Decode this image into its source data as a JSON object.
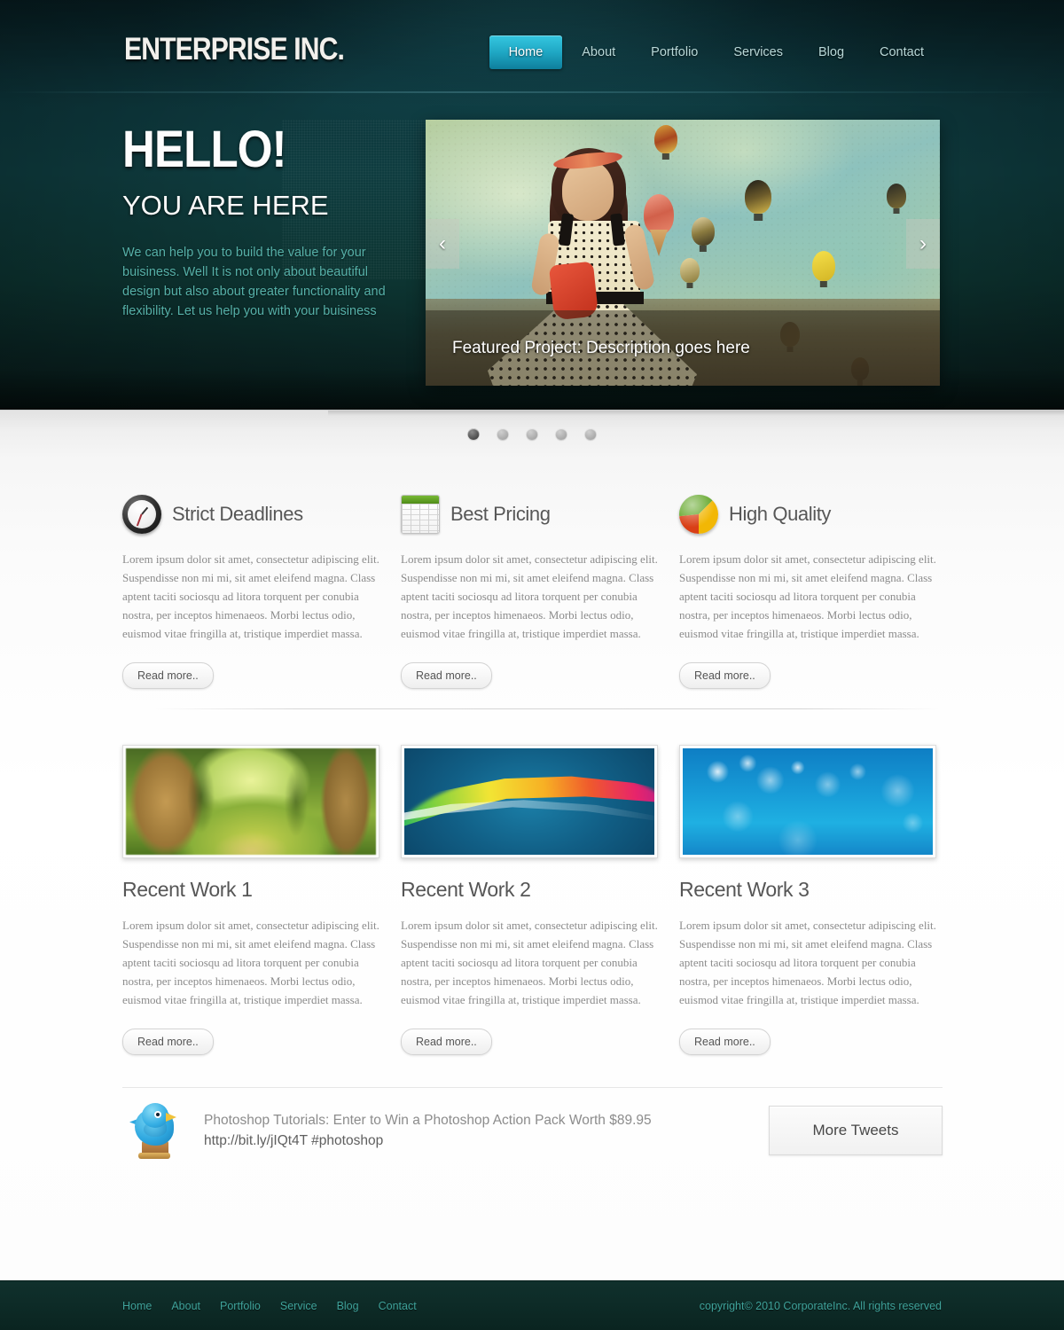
{
  "site": {
    "logo": "ENTERPRISE INC."
  },
  "nav": {
    "items": [
      {
        "label": "Home",
        "active": true
      },
      {
        "label": "About",
        "active": false
      },
      {
        "label": "Portfolio",
        "active": false
      },
      {
        "label": "Services",
        "active": false
      },
      {
        "label": "Blog",
        "active": false
      },
      {
        "label": "Contact",
        "active": false
      }
    ]
  },
  "hero": {
    "title": "HELLO!",
    "subtitle": "YOU ARE HERE",
    "paragraph": "We can help you to build the value for your buisiness. Well It is not only about beautiful design but also about greater functionality and flexibility. Let us help you with your buisiness"
  },
  "slider": {
    "caption": "Featured Project: Description goes here",
    "prev_arrow": "‹",
    "next_arrow": "›",
    "pagination": [
      {
        "index": 1,
        "active": true
      },
      {
        "index": 2,
        "active": false
      },
      {
        "index": 3,
        "active": false
      },
      {
        "index": 4,
        "active": false
      },
      {
        "index": 5,
        "active": false
      }
    ]
  },
  "features": [
    {
      "icon": "clock-icon",
      "title": "Strict Deadlines",
      "body": "Lorem ipsum dolor sit amet, consectetur adipiscing elit. Suspendisse non mi mi, sit amet eleifend magna. Class aptent taciti sociosqu ad litora torquent per conubia nostra, per inceptos himenaeos. Morbi lectus odio, euismod vitae fringilla at, tristique imperdiet massa.",
      "read_more": "Read more.."
    },
    {
      "icon": "spreadsheet-icon",
      "title": "Best Pricing",
      "body": "Lorem ipsum dolor sit amet, consectetur adipiscing elit. Suspendisse non mi mi, sit amet eleifend magna. Class aptent taciti sociosqu ad litora torquent per conubia nostra, per inceptos himenaeos. Morbi lectus odio, euismod vitae fringilla at, tristique imperdiet massa.",
      "read_more": "Read more.."
    },
    {
      "icon": "pie-chart-icon",
      "title": "High Quality",
      "body": "Lorem ipsum dolor sit amet, consectetur adipiscing elit. Suspendisse non mi mi, sit amet eleifend magna. Class aptent taciti sociosqu ad litora torquent per conubia nostra, per inceptos himenaeos. Morbi lectus odio, euismod vitae fringilla at, tristique imperdiet massa.",
      "read_more": "Read more.."
    }
  ],
  "works": [
    {
      "title": "Recent Work 1",
      "image": "forest-path-photo",
      "body": "Lorem ipsum dolor sit amet, consectetur adipiscing elit. Suspendisse non mi mi, sit amet eleifend magna. Class aptent taciti sociosqu ad litora torquent per conubia nostra, per inceptos himenaeos. Morbi lectus odio, euismod vitae fringilla at, tristique imperdiet massa.",
      "read_more": "Read more.."
    },
    {
      "title": "Recent Work 2",
      "image": "rainbow-wave-graphic",
      "body": "Lorem ipsum dolor sit amet, consectetur adipiscing elit. Suspendisse non mi mi, sit amet eleifend magna. Class aptent taciti sociosqu ad litora torquent per conubia nostra, per inceptos himenaeos. Morbi lectus odio, euismod vitae fringilla at, tristique imperdiet massa.",
      "read_more": "Read more.."
    },
    {
      "title": "Recent Work 3",
      "image": "blue-bokeh-graphic",
      "body": "Lorem ipsum dolor sit amet, consectetur adipiscing elit. Suspendisse non mi mi, sit amet eleifend magna. Class aptent taciti sociosqu ad litora torquent per conubia nostra, per inceptos himenaeos. Morbi lectus odio, euismod vitae fringilla at, tristique imperdiet massa.",
      "read_more": "Read more.."
    }
  ],
  "twitter": {
    "icon": "twitter-bird-icon",
    "tweet_line1": "Photoshop Tutorials: Enter to Win a Photoshop Action Pack Worth $89.95",
    "tweet_line2": "http://bit.ly/jIQt4T #photoshop",
    "more_button": "More Tweets"
  },
  "footer": {
    "nav": [
      "Home",
      "About",
      "Portfolio",
      "Service",
      "Blog",
      "Contact"
    ],
    "copyright": "copyright©  2010 CorporateInc. All rights reserved"
  },
  "colors": {
    "header_dark": "#0d363c",
    "accent_cyan": "#1fa7c4",
    "teal_text": "#56b0a8",
    "footer_bg": "#0d2b27",
    "footer_link": "#3fa39b",
    "body_text": "#8b8b8b"
  }
}
